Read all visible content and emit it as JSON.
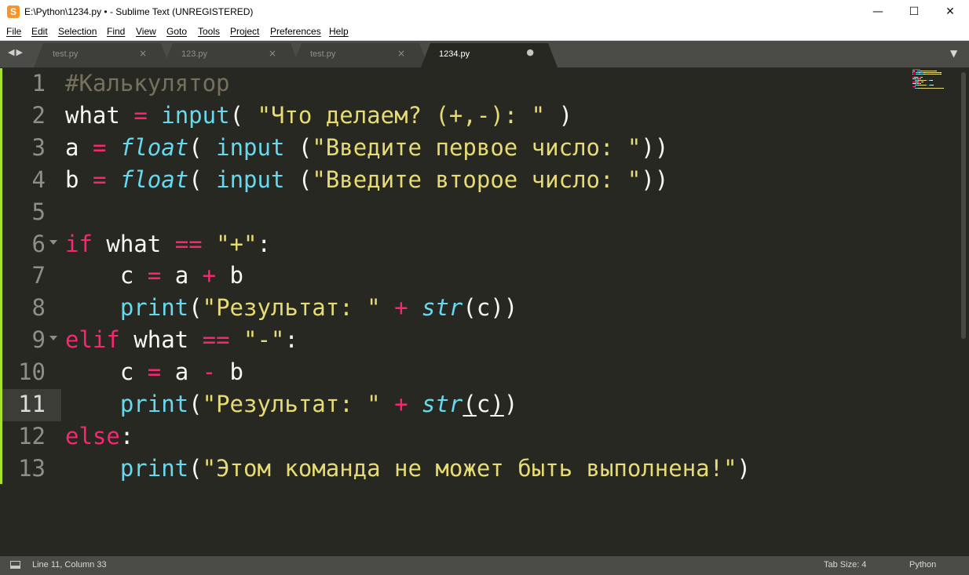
{
  "window": {
    "title": "E:\\Python\\1234.py • - Sublime Text (UNREGISTERED)",
    "minimize_glyph": "—",
    "maximize_glyph": "☐",
    "close_glyph": "✕"
  },
  "menu": [
    "File",
    "Edit",
    "Selection",
    "Find",
    "View",
    "Goto",
    "Tools",
    "Project",
    "Preferences",
    "Help"
  ],
  "tabs": [
    {
      "label": "test.py",
      "close": "×",
      "active": false
    },
    {
      "label": "123.py",
      "close": "×",
      "active": false
    },
    {
      "label": "test.py",
      "close": "×",
      "active": false
    },
    {
      "label": "1234.py",
      "close": "●",
      "active": true
    }
  ],
  "nav_arrows": "◀▶",
  "tab_menu_glyph": "▼",
  "editor": {
    "current_line": 11,
    "lines": [
      {
        "n": "1",
        "tokens": [
          {
            "t": "#Калькулятор",
            "c": "comment"
          }
        ]
      },
      {
        "n": "2",
        "tokens": [
          {
            "t": "what",
            "c": "var"
          },
          {
            "t": " "
          },
          {
            "t": "=",
            "c": "op"
          },
          {
            "t": " "
          },
          {
            "t": "input",
            "c": "func"
          },
          {
            "t": "( ",
            "c": "punc"
          },
          {
            "t": "\"Что делаем? (+,-): \"",
            "c": "str"
          },
          {
            "t": " )",
            "c": "punc"
          }
        ]
      },
      {
        "n": "3",
        "tokens": [
          {
            "t": "a",
            "c": "var"
          },
          {
            "t": " "
          },
          {
            "t": "=",
            "c": "op"
          },
          {
            "t": " "
          },
          {
            "t": "float",
            "c": "type"
          },
          {
            "t": "( ",
            "c": "punc"
          },
          {
            "t": "input",
            "c": "func"
          },
          {
            "t": " (",
            "c": "punc"
          },
          {
            "t": "\"Введите первое число: \"",
            "c": "str"
          },
          {
            "t": "))",
            "c": "punc"
          }
        ]
      },
      {
        "n": "4",
        "tokens": [
          {
            "t": "b",
            "c": "var"
          },
          {
            "t": " "
          },
          {
            "t": "=",
            "c": "op"
          },
          {
            "t": " "
          },
          {
            "t": "float",
            "c": "type"
          },
          {
            "t": "( ",
            "c": "punc"
          },
          {
            "t": "input",
            "c": "func"
          },
          {
            "t": " (",
            "c": "punc"
          },
          {
            "t": "\"Введите второе число: \"",
            "c": "str"
          },
          {
            "t": "))",
            "c": "punc"
          }
        ]
      },
      {
        "n": "5",
        "tokens": []
      },
      {
        "n": "6",
        "fold": true,
        "tokens": [
          {
            "t": "if",
            "c": "kw"
          },
          {
            "t": " what "
          },
          {
            "t": "==",
            "c": "op"
          },
          {
            "t": " "
          },
          {
            "t": "\"+\"",
            "c": "str"
          },
          {
            "t": ":",
            "c": "punc"
          }
        ]
      },
      {
        "n": "7",
        "tokens": [
          {
            "t": "    c "
          },
          {
            "t": "=",
            "c": "op"
          },
          {
            "t": " a "
          },
          {
            "t": "+",
            "c": "op"
          },
          {
            "t": " b"
          }
        ]
      },
      {
        "n": "8",
        "tokens": [
          {
            "t": "    "
          },
          {
            "t": "print",
            "c": "func"
          },
          {
            "t": "(",
            "c": "punc"
          },
          {
            "t": "\"Результат: \"",
            "c": "str"
          },
          {
            "t": " "
          },
          {
            "t": "+",
            "c": "op"
          },
          {
            "t": " "
          },
          {
            "t": "str",
            "c": "type"
          },
          {
            "t": "(c))",
            "c": "punc"
          }
        ]
      },
      {
        "n": "9",
        "fold": true,
        "tokens": [
          {
            "t": "elif",
            "c": "kw"
          },
          {
            "t": " what "
          },
          {
            "t": "==",
            "c": "op"
          },
          {
            "t": " "
          },
          {
            "t": "\"-\"",
            "c": "str"
          },
          {
            "t": ":",
            "c": "punc"
          }
        ]
      },
      {
        "n": "10",
        "tokens": [
          {
            "t": "    c "
          },
          {
            "t": "=",
            "c": "op"
          },
          {
            "t": " a "
          },
          {
            "t": "-",
            "c": "op"
          },
          {
            "t": " b"
          }
        ]
      },
      {
        "n": "11",
        "tokens": [
          {
            "t": "    "
          },
          {
            "t": "print",
            "c": "func"
          },
          {
            "t": "(",
            "c": "punc"
          },
          {
            "t": "\"Результат: \"",
            "c": "str"
          },
          {
            "t": " "
          },
          {
            "t": "+",
            "c": "op"
          },
          {
            "t": " "
          },
          {
            "t": "str",
            "c": "type"
          },
          {
            "t": "(",
            "c": "punc u"
          },
          {
            "t": "c"
          },
          {
            "t": ")",
            "c": "punc u"
          },
          {
            "t": ")",
            "c": "punc"
          }
        ]
      },
      {
        "n": "12",
        "tokens": [
          {
            "t": "else",
            "c": "kw"
          },
          {
            "t": ":",
            "c": "punc"
          }
        ]
      },
      {
        "n": "13",
        "tokens": [
          {
            "t": "    "
          },
          {
            "t": "print",
            "c": "func"
          },
          {
            "t": "(",
            "c": "punc"
          },
          {
            "t": "\"Этом команда не может быть выполнена!\"",
            "c": "str"
          },
          {
            "t": ")",
            "c": "punc"
          }
        ]
      }
    ]
  },
  "status": {
    "position": "Line 11, Column 33",
    "tab_size": "Tab Size: 4",
    "syntax": "Python"
  },
  "colors": {
    "background": "#272822",
    "comment": "#75715e",
    "string": "#e6db74",
    "keyword": "#f92672",
    "function": "#66d9ef",
    "modified_marker": "#a6e22e"
  }
}
